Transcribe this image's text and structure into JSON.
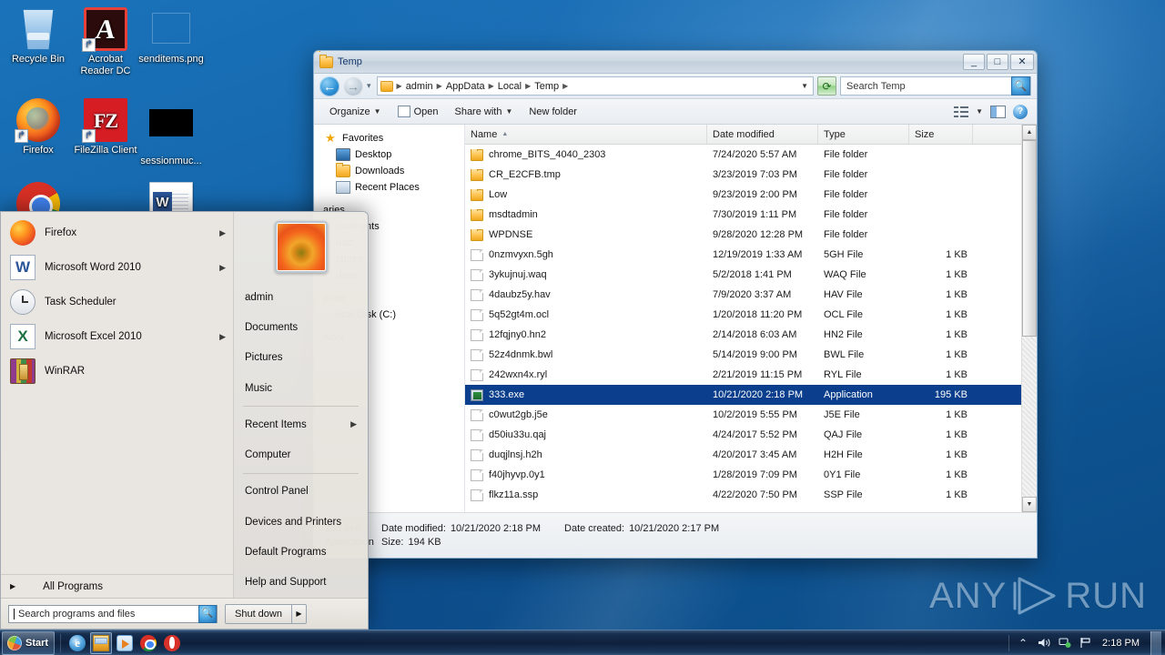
{
  "desktop": {
    "icons": [
      {
        "label": "Recycle Bin",
        "icon": "recycle-bin-icon",
        "shortcut": false
      },
      {
        "label": "Acrobat Reader DC",
        "icon": "acrobat-reader-icon",
        "shortcut": true
      },
      {
        "label": "senditems.png",
        "icon": "image-thumbnail-icon",
        "shortcut": false
      },
      {
        "label": "Firefox",
        "icon": "firefox-icon",
        "shortcut": true
      },
      {
        "label": "FileZilla Client",
        "icon": "filezilla-icon",
        "shortcut": true
      },
      {
        "label": "sessionmuc...",
        "icon": "image-thumbnail-icon",
        "shortcut": false
      },
      {
        "label": "",
        "icon": "chrome-icon",
        "shortcut": true
      },
      {
        "label": "",
        "icon": "word-document-icon",
        "shortcut": false
      }
    ],
    "watermark": "ANY RUN",
    "watermark_left": "ANY",
    "watermark_right": "RUN"
  },
  "explorer": {
    "title": "Temp",
    "window_controls": {
      "minimize": "_",
      "maximize": "□",
      "close": "✕"
    },
    "address": {
      "crumbs": [
        "admin",
        "AppData",
        "Local",
        "Temp"
      ],
      "dropdown_caret": "▼",
      "refresh_icon": "refresh-icon"
    },
    "search": {
      "placeholder": "Search Temp",
      "icon": "search-icon"
    },
    "toolbar": {
      "organize": "Organize",
      "open": "Open",
      "share_with": "Share with",
      "new_folder": "New folder",
      "caret": "▼",
      "view_icon": "list-view-icon",
      "preview_pane_icon": "preview-pane-icon",
      "help_icon": "help-icon"
    },
    "navpane": {
      "favorites": "Favorites",
      "favorites_items": [
        "Desktop",
        "Downloads",
        "Recent Places"
      ],
      "libraries": "aries",
      "libraries_items": [
        "ocuments",
        "usic",
        "ctures",
        "deos"
      ],
      "computer": "puter",
      "computer_items": [
        "ocal Disk (C:)"
      ],
      "network": "work"
    },
    "columns": [
      {
        "key": "name",
        "label": "Name",
        "sorted": true,
        "sort_arrow": "▲"
      },
      {
        "key": "date",
        "label": "Date modified"
      },
      {
        "key": "type",
        "label": "Type"
      },
      {
        "key": "size",
        "label": "Size"
      }
    ],
    "files": [
      {
        "name": "chrome_BITS_4040_2303",
        "date": "7/24/2020 5:57 AM",
        "type": "File folder",
        "size": "",
        "icon": "folder-icon",
        "selected": false
      },
      {
        "name": "CR_E2CFB.tmp",
        "date": "3/23/2019 7:03 PM",
        "type": "File folder",
        "size": "",
        "icon": "folder-icon",
        "selected": false
      },
      {
        "name": "Low",
        "date": "9/23/2019 2:00 PM",
        "type": "File folder",
        "size": "",
        "icon": "folder-icon",
        "selected": false
      },
      {
        "name": "msdtadmin",
        "date": "7/30/2019 1:11 PM",
        "type": "File folder",
        "size": "",
        "icon": "folder-icon",
        "selected": false
      },
      {
        "name": "WPDNSE",
        "date": "9/28/2020 12:28 PM",
        "type": "File folder",
        "size": "",
        "icon": "folder-icon",
        "selected": false
      },
      {
        "name": "0nzmvyxn.5gh",
        "date": "12/19/2019 1:33 AM",
        "type": "5GH File",
        "size": "1 KB",
        "icon": "file-icon",
        "selected": false
      },
      {
        "name": "3ykujnuj.waq",
        "date": "5/2/2018 1:41 PM",
        "type": "WAQ File",
        "size": "1 KB",
        "icon": "file-icon",
        "selected": false
      },
      {
        "name": "4daubz5y.hav",
        "date": "7/9/2020 3:37 AM",
        "type": "HAV File",
        "size": "1 KB",
        "icon": "file-icon",
        "selected": false
      },
      {
        "name": "5q52gt4m.ocl",
        "date": "1/20/2018 11:20 PM",
        "type": "OCL File",
        "size": "1 KB",
        "icon": "file-icon",
        "selected": false
      },
      {
        "name": "12fqjny0.hn2",
        "date": "2/14/2018 6:03 AM",
        "type": "HN2 File",
        "size": "1 KB",
        "icon": "file-icon",
        "selected": false
      },
      {
        "name": "52z4dnmk.bwl",
        "date": "5/14/2019 9:00 PM",
        "type": "BWL File",
        "size": "1 KB",
        "icon": "file-icon",
        "selected": false
      },
      {
        "name": "242wxn4x.ryl",
        "date": "2/21/2019 11:15 PM",
        "type": "RYL File",
        "size": "1 KB",
        "icon": "file-icon",
        "selected": false
      },
      {
        "name": "333.exe",
        "date": "10/21/2020 2:18 PM",
        "type": "Application",
        "size": "195 KB",
        "icon": "application-icon",
        "selected": true
      },
      {
        "name": "c0wut2gb.j5e",
        "date": "10/2/2019 5:55 PM",
        "type": "J5E File",
        "size": "1 KB",
        "icon": "file-icon",
        "selected": false
      },
      {
        "name": "d50iu33u.qaj",
        "date": "4/24/2017 5:52 PM",
        "type": "QAJ File",
        "size": "1 KB",
        "icon": "file-icon",
        "selected": false
      },
      {
        "name": "duqjlnsj.h2h",
        "date": "4/20/2017 3:45 AM",
        "type": "H2H File",
        "size": "1 KB",
        "icon": "file-icon",
        "selected": false
      },
      {
        "name": "f40jhyvp.0y1",
        "date": "1/28/2019 7:09 PM",
        "type": "0Y1 File",
        "size": "1 KB",
        "icon": "file-icon",
        "selected": false
      },
      {
        "name": "flkz11a.ssp",
        "date": "4/22/2020 7:50 PM",
        "type": "SSP File",
        "size": "1 KB",
        "icon": "file-icon",
        "selected": false
      }
    ],
    "details": {
      "file_name": "333.exe",
      "date_modified_label": "Date modified:",
      "date_modified_value": "10/21/2020 2:18 PM",
      "date_created_label": "Date created:",
      "date_created_value": "10/21/2020 2:17 PM",
      "type_value": "Application",
      "size_label": "Size:",
      "size_value": "194 KB"
    }
  },
  "start_menu": {
    "programs": [
      {
        "label": "Firefox",
        "icon": "firefox-icon",
        "has_submenu": true
      },
      {
        "label": "Microsoft Word 2010",
        "icon": "word-icon",
        "has_submenu": true
      },
      {
        "label": "Task Scheduler",
        "icon": "task-scheduler-icon",
        "has_submenu": false
      },
      {
        "label": "Microsoft Excel 2010",
        "icon": "excel-icon",
        "has_submenu": true
      },
      {
        "label": "WinRAR",
        "icon": "winrar-icon",
        "has_submenu": false
      }
    ],
    "all_programs": "All Programs",
    "user_name": "admin",
    "avatar_icon": "user-avatar",
    "right_items": [
      {
        "label": "Documents",
        "has_submenu": false
      },
      {
        "label": "Pictures",
        "has_submenu": false
      },
      {
        "label": "Music",
        "has_submenu": false
      },
      {
        "label": "Recent Items",
        "has_submenu": true
      },
      {
        "label": "Computer",
        "has_submenu": false
      },
      {
        "label": "Control Panel",
        "has_submenu": false
      },
      {
        "label": "Devices and Printers",
        "has_submenu": false
      },
      {
        "label": "Default Programs",
        "has_submenu": false
      },
      {
        "label": "Help and Support",
        "has_submenu": false
      }
    ],
    "search_placeholder": "Search programs and files",
    "search_icon": "search-icon",
    "shutdown_label": "Shut down",
    "shutdown_caret": "▶"
  },
  "taskbar": {
    "start_label": "Start",
    "start_icon": "windows-orb-icon",
    "quick_launch": [
      {
        "icon": "internet-explorer-icon",
        "active": false
      },
      {
        "icon": "windows-explorer-icon",
        "active": true
      },
      {
        "icon": "windows-media-player-icon",
        "active": false
      },
      {
        "icon": "chrome-icon",
        "active": false
      },
      {
        "icon": "opera-icon",
        "active": false
      }
    ],
    "tray": [
      {
        "icon": "show-hidden-icons-icon",
        "glyph": "⌃"
      },
      {
        "icon": "volume-icon",
        "glyph": "🔊"
      },
      {
        "icon": "network-icon",
        "glyph": "🖧"
      },
      {
        "icon": "action-center-flag-icon",
        "glyph": "⚑"
      }
    ],
    "clock": "2:18 PM",
    "show_desktop": "show-desktop-button"
  }
}
